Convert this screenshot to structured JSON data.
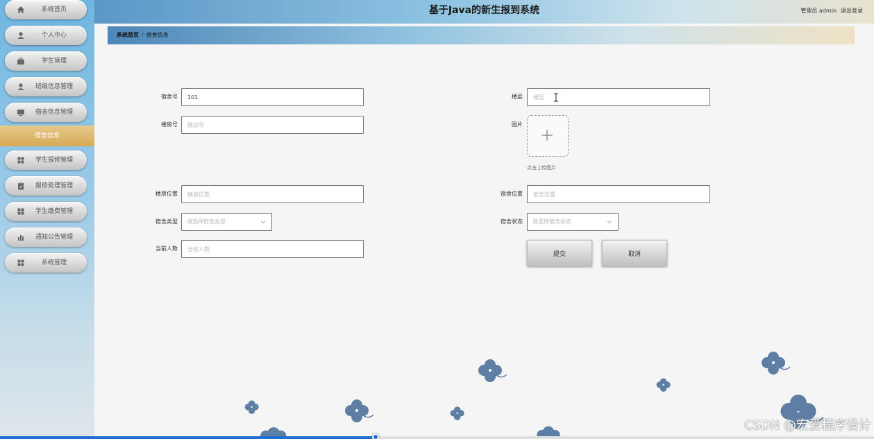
{
  "app": {
    "title": "基于Java的新生报到系统",
    "user_label": "管理员 admin",
    "logout_label": "退出登录"
  },
  "sidebar": {
    "items": [
      {
        "label": "系统首页",
        "icon": "home-icon"
      },
      {
        "label": "个人中心",
        "icon": "user-icon"
      },
      {
        "label": "学生管理",
        "icon": "briefcase-icon"
      },
      {
        "label": "班级信息管理",
        "icon": "user-icon"
      },
      {
        "label": "宿舍信息管理",
        "icon": "monitor-icon"
      },
      {
        "label": "学生报修管理",
        "icon": "grid-icon"
      },
      {
        "label": "报修处理管理",
        "icon": "clipboard-icon"
      },
      {
        "label": "学生缴费管理",
        "icon": "grid-icon"
      },
      {
        "label": "通知公告管理",
        "icon": "bar-chart-icon"
      },
      {
        "label": "系统管理",
        "icon": "grid-icon"
      }
    ],
    "active_sub": "宿舍信息"
  },
  "breadcrumb": {
    "home": "系统首页",
    "separator": "/",
    "current": "宿舍信息"
  },
  "form": {
    "dorm_no": {
      "label": "宿舍号",
      "value": "101",
      "placeholder": "宿舍号"
    },
    "floor": {
      "label": "楼层",
      "value": "",
      "placeholder": "楼层"
    },
    "building_no": {
      "label": "楼房号",
      "value": "",
      "placeholder": "楼房号"
    },
    "image": {
      "label": "图片",
      "hint": "点击上传图片"
    },
    "building_location": {
      "label": "楼房位置",
      "value": "",
      "placeholder": "楼房位置"
    },
    "dorm_location": {
      "label": "宿舍位置",
      "value": "",
      "placeholder": "宿舍位置"
    },
    "dorm_type": {
      "label": "宿舍类型",
      "placeholder": "请选择宿舍类型"
    },
    "dorm_status": {
      "label": "宿舍状态",
      "placeholder": "请选择宿舍状态"
    },
    "current_count": {
      "label": "当前人数",
      "value": "",
      "placeholder": "当前人数"
    },
    "submit_label": "提交",
    "cancel_label": "取消"
  },
  "watermark": "CSDN @宏爱程序设计",
  "progress": 0.43,
  "colors": {
    "accent_active": "#d6a955",
    "flower": "#5e7fa3",
    "progress": "#1f6fd0"
  }
}
